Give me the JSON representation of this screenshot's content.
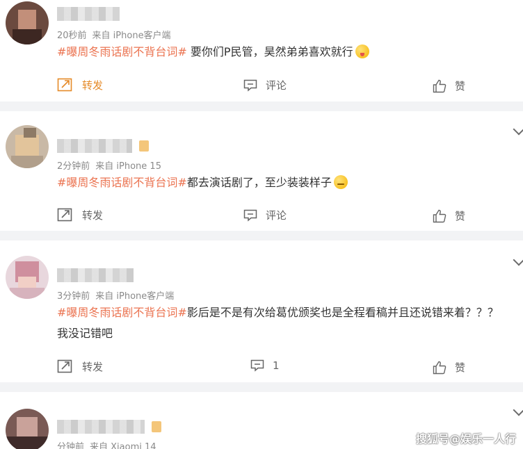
{
  "colors": {
    "accent": "#eb7350",
    "repost_highlight": "#e58a28",
    "separator": "#f2f3f5",
    "meta_text": "#8a8a8a"
  },
  "posts": [
    {
      "time": "20秒前",
      "source": "来自 iPhone客户端",
      "tag": "#曝周冬雨话剧不背台词#",
      "text": " 要你们P民管，昊然弟弟喜欢就行",
      "emoji": "tongue-out-emoji",
      "actions": {
        "repost": "转发",
        "comment": "评论",
        "like": "赞"
      }
    },
    {
      "time": "2分钟前",
      "source": "来自 iPhone 15",
      "tag": "#曝周冬雨话剧不背台词#",
      "text": "都去演话剧了，至少装装样子",
      "emoji": "smirk-emoji",
      "actions": {
        "repost": "转发",
        "comment": "评论",
        "like": "赞"
      }
    },
    {
      "time": "3分钟前",
      "source": "来自 iPhone客户端",
      "tag": "#曝周冬雨话剧不背台词#",
      "text": "影后是不是有次给葛优颁奖也是全程看稿并且还说错来着？？？ 我没记错吧",
      "actions": {
        "repost": "转发",
        "comment": "1",
        "like": "赞"
      }
    },
    {
      "time": "分钟前",
      "source": "来自 Xiaomi 14"
    }
  ],
  "watermark": "搜狐号@娱乐一人行"
}
